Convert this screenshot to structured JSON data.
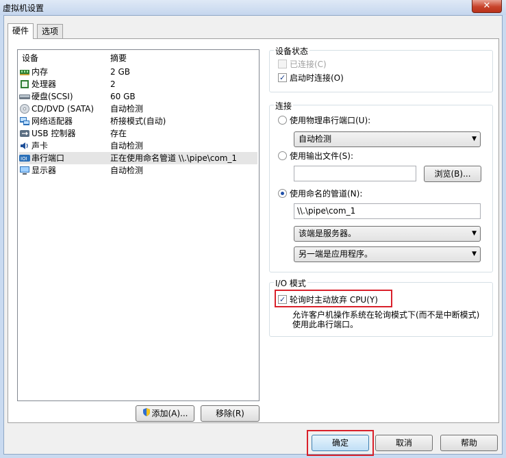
{
  "window": {
    "title": "虚拟机设置",
    "close_label": "✕"
  },
  "tabs": [
    {
      "label": "硬件"
    },
    {
      "label": "选项"
    }
  ],
  "device_list": {
    "headers": {
      "device": "设备",
      "summary": "摘要"
    },
    "rows": [
      {
        "device": "内存",
        "summary": "2 GB",
        "icon": "memory-icon"
      },
      {
        "device": "处理器",
        "summary": "2",
        "icon": "processor-icon"
      },
      {
        "device": "硬盘(SCSI)",
        "summary": "60 GB",
        "icon": "harddisk-icon"
      },
      {
        "device": "CD/DVD (SATA)",
        "summary": "自动检测",
        "icon": "cdrom-icon"
      },
      {
        "device": "网络适配器",
        "summary": "桥接模式(自动)",
        "icon": "network-icon"
      },
      {
        "device": "USB 控制器",
        "summary": "存在",
        "icon": "usb-icon"
      },
      {
        "device": "声卡",
        "summary": "自动检测",
        "icon": "sound-icon"
      },
      {
        "device": "串行端口",
        "summary": "正在使用命名管道 \\\\.\\pipe\\com_1",
        "icon": "serial-port-icon"
      },
      {
        "device": "显示器",
        "summary": "自动检测",
        "icon": "display-icon"
      }
    ],
    "add_button": "添加(A)...",
    "remove_button": "移除(R)"
  },
  "device_status": {
    "title": "设备状态",
    "connected": "已连接(C)",
    "connect_at_power_on": "启动时连接(O)"
  },
  "connection": {
    "title": "连接",
    "physical_port": "使用物理串行端口(U):",
    "physical_port_value": "自动检测",
    "output_file": "使用输出文件(S):",
    "output_file_value": "",
    "browse": "浏览(B)...",
    "named_pipe": "使用命名的管道(N):",
    "pipe_name": "\\\\.\\pipe\\com_1",
    "this_end": "该端是服务器。",
    "other_end": "另一端是应用程序。"
  },
  "io_mode": {
    "title": "I/O 模式",
    "yield_cpu": "轮询时主动放弃 CPU(Y)",
    "description": "允许客户机操作系统在轮询模式下(而不是中断模式)使用此串行端口。"
  },
  "footer": {
    "ok": "确定",
    "cancel": "取消",
    "help": "帮助"
  },
  "colors": {
    "highlight": "#d9202a",
    "title_bar": "#c5d6ee",
    "close_button": "#c8432b"
  }
}
